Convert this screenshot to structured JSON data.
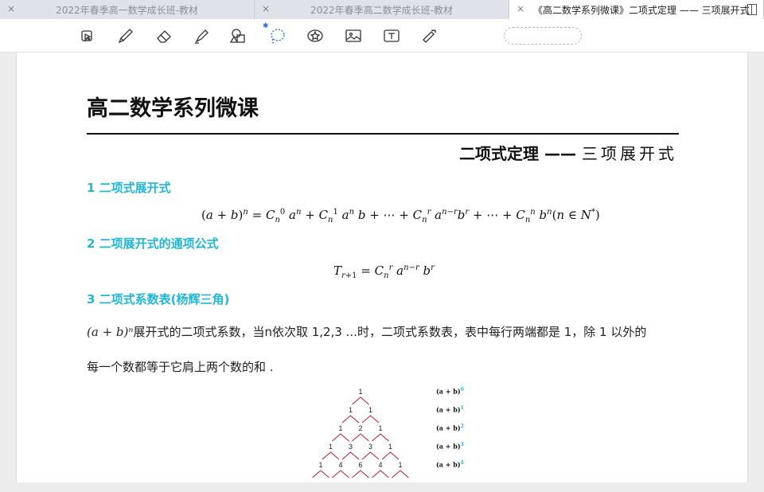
{
  "tabs": [
    {
      "label": "2022年春季高一数学成长班-教材",
      "close": "×"
    },
    {
      "label": "2022年春季高二数学成长班-教材",
      "close": "×"
    },
    {
      "label": "《高二数学系列微课》二项式定理 —— 三项展开式",
      "close": "×"
    }
  ],
  "toolbar": {
    "tools": [
      "pointer-icon",
      "pen-icon",
      "eraser-icon",
      "highlighter-icon",
      "shapes-icon",
      "lasso-icon",
      "sticker-icon",
      "image-icon",
      "text-icon",
      "laser-pointer-icon"
    ],
    "bluetooth_glyph": "✱"
  },
  "document": {
    "title": "高二数学系列微课",
    "subtitle_main": "二项式定理 ——",
    "subtitle_topic": "三项展开式",
    "sections": [
      {
        "num": "1",
        "title": "二项式展开式"
      },
      {
        "num": "2",
        "title": "二项展开式的通项公式"
      },
      {
        "num": "3",
        "title": "二项式系数表(杨辉三角)"
      }
    ],
    "paragraph_line1": "展开式的二项式系数，当n依次取 1,2,3 ...时，二项式系数表，表中每行两端都是 1，除 1 以外的",
    "paragraph_line2": "每一个数都等于它肩上两个数的和 .",
    "paragraph_prefix": "(a + b)ⁿ"
  },
  "pascal": {
    "rows": [
      [
        1
      ],
      [
        1,
        1
      ],
      [
        1,
        2,
        1
      ],
      [
        1,
        3,
        3,
        1
      ],
      [
        1,
        4,
        6,
        4,
        1
      ]
    ],
    "powers": [
      "0",
      "1",
      "2",
      "3",
      "4"
    ],
    "power_base": "(a + b)",
    "colors": {
      "lines": "#c0142a",
      "power_exp": "#1fb6d8"
    }
  },
  "colors": {
    "accent": "#1fb6d8",
    "active_tab": "#ffffff",
    "inactive_tab": "#dfe2e8"
  }
}
